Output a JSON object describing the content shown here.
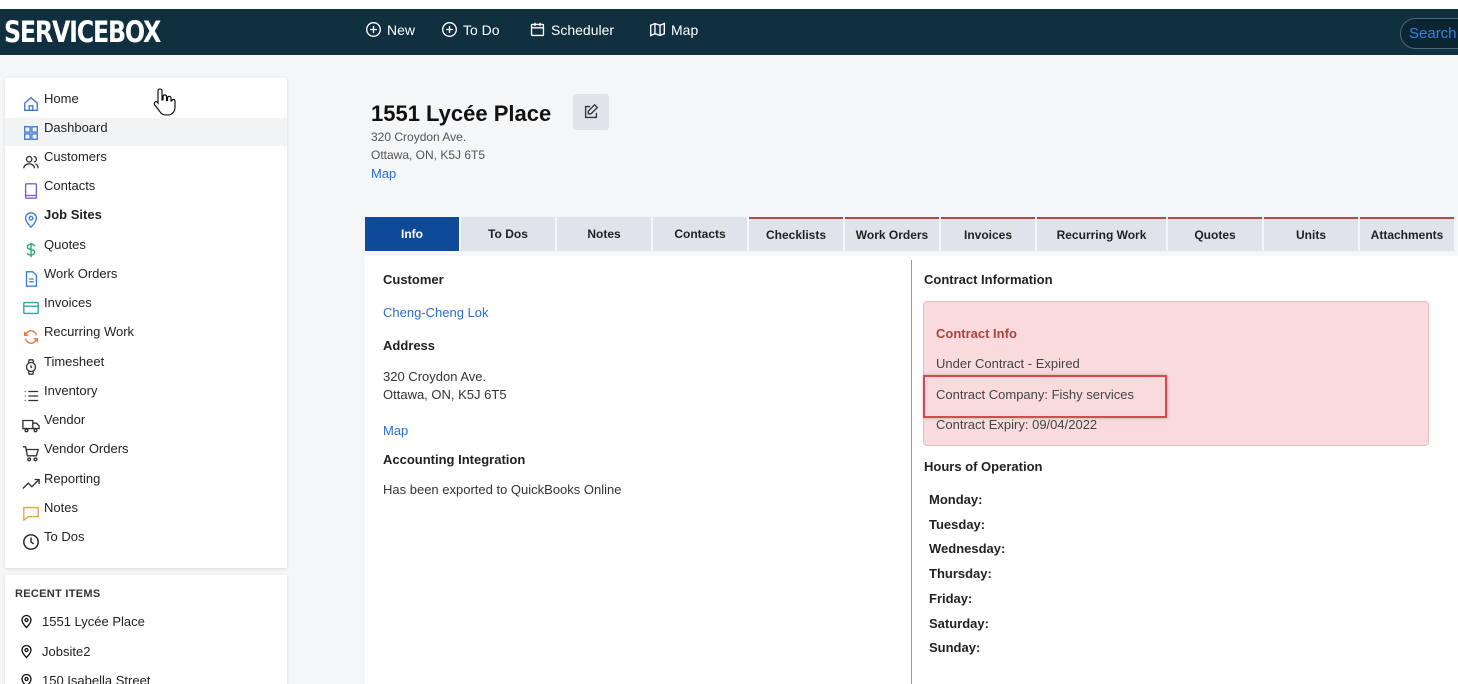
{
  "app": {
    "logo": "SERVICEBOX"
  },
  "topnav": {
    "items": [
      {
        "label": "New",
        "icon": "plus-circle-icon"
      },
      {
        "label": "To Do",
        "icon": "plus-circle-icon"
      },
      {
        "label": "Scheduler",
        "icon": "calendar-icon"
      },
      {
        "label": "Map",
        "icon": "map-icon"
      }
    ],
    "search_placeholder": "Search"
  },
  "sidebar": {
    "items": [
      {
        "label": "Home",
        "icon": "home-icon"
      },
      {
        "label": "Dashboard",
        "icon": "grid-icon"
      },
      {
        "label": "Customers",
        "icon": "users-icon"
      },
      {
        "label": "Contacts",
        "icon": "contact-book-icon"
      },
      {
        "label": "Job Sites",
        "icon": "location-pin-icon"
      },
      {
        "label": "Quotes",
        "icon": "dollar-icon"
      },
      {
        "label": "Work Orders",
        "icon": "document-icon"
      },
      {
        "label": "Invoices",
        "icon": "credit-card-icon"
      },
      {
        "label": "Recurring Work",
        "icon": "refresh-icon"
      },
      {
        "label": "Timesheet",
        "icon": "watch-icon"
      },
      {
        "label": "Inventory",
        "icon": "list-icon"
      },
      {
        "label": "Vendor",
        "icon": "truck-icon"
      },
      {
        "label": "Vendor Orders",
        "icon": "cart-icon"
      },
      {
        "label": "Reporting",
        "icon": "trending-up-icon"
      },
      {
        "label": "Notes",
        "icon": "comment-icon"
      },
      {
        "label": "To Dos",
        "icon": "clock-icon"
      }
    ]
  },
  "recent": {
    "title": "RECENT ITEMS",
    "items": [
      {
        "label": "1551 Lycée Place"
      },
      {
        "label": "Jobsite2"
      },
      {
        "label": "150 Isabella Street"
      }
    ]
  },
  "jobsite": {
    "title": "1551 Lycée Place",
    "address_line1": "320 Croydon Ave.",
    "address_line2": "Ottawa, ON, K5J 6T5",
    "map_link": "Map"
  },
  "tabs": [
    {
      "label": "Info"
    },
    {
      "label": "To Dos"
    },
    {
      "label": "Notes"
    },
    {
      "label": "Contacts"
    },
    {
      "label": "Checklists"
    },
    {
      "label": "Work Orders"
    },
    {
      "label": "Invoices"
    },
    {
      "label": "Recurring Work"
    },
    {
      "label": "Quotes"
    },
    {
      "label": "Units"
    },
    {
      "label": "Attachments"
    }
  ],
  "info": {
    "customer_label": "Customer",
    "customer_name": "Cheng-Cheng Lok",
    "address_label": "Address",
    "address_line1": "320 Croydon Ave.",
    "address_line2": "Ottawa, ON, K5J 6T5",
    "map_link": "Map",
    "accounting_label": "Accounting Integration",
    "accounting_value": "Has been exported to QuickBooks Online"
  },
  "contract": {
    "section_title": "Contract Information",
    "box_title": "Contract Info",
    "status": "Under Contract - Expired",
    "company": "Contract Company: Fishy services",
    "expiry": "Contract Expiry: 09/04/2022"
  },
  "hours": {
    "title": "Hours of Operation",
    "days": [
      "Monday:",
      "Tuesday:",
      "Wednesday:",
      "Thursday:",
      "Friday:",
      "Saturday:",
      "Sunday:"
    ]
  },
  "colors": {
    "topbar": "#10303f",
    "active_tab": "#0e4a97",
    "link": "#2a6fc9",
    "contract_bg": "#f9dbdd",
    "highlight": "#d9484c"
  }
}
